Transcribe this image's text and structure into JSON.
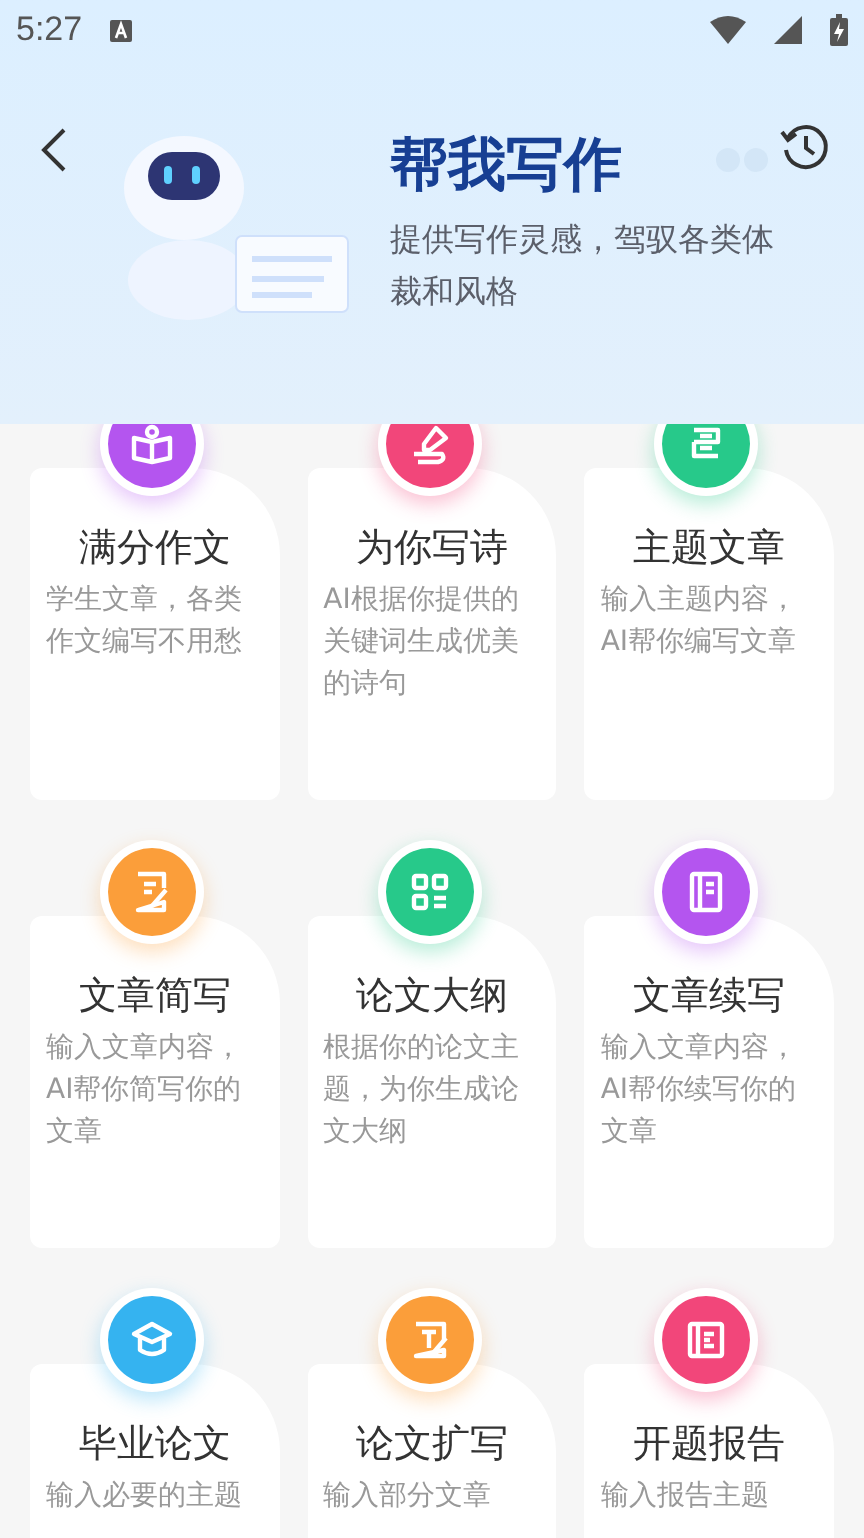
{
  "status_bar": {
    "time": "5:27"
  },
  "header": {
    "title": "帮我写作",
    "subtitle": "提供写作灵感，驾驭各类体裁和风格"
  },
  "tools": [
    {
      "title": "满分作文",
      "description": "学生文章，各类作文编写不用愁",
      "color": "#b455ef"
    },
    {
      "title": "为你写诗",
      "description": "AI根据你提供的关键词生成优美的诗句",
      "color": "#f2467a"
    },
    {
      "title": "主题文章",
      "description": "输入主题内容，AI帮你编写文章",
      "color": "#27c98a"
    },
    {
      "title": "文章简写",
      "description": "输入文章内容，AI帮你简写你的文章",
      "color": "#fb9e3a"
    },
    {
      "title": "论文大纲",
      "description": "根据你的论文主题，为你生成论文大纲",
      "color": "#27c98a"
    },
    {
      "title": "文章续写",
      "description": "输入文章内容，AI帮你续写你的文章",
      "color": "#b455ef"
    },
    {
      "title": "毕业论文",
      "description": "输入必要的主题",
      "color": "#35b3f0"
    },
    {
      "title": "论文扩写",
      "description": "输入部分文章",
      "color": "#fb9e3a"
    },
    {
      "title": "开题报告",
      "description": "输入报告主题",
      "color": "#f2467a"
    }
  ]
}
